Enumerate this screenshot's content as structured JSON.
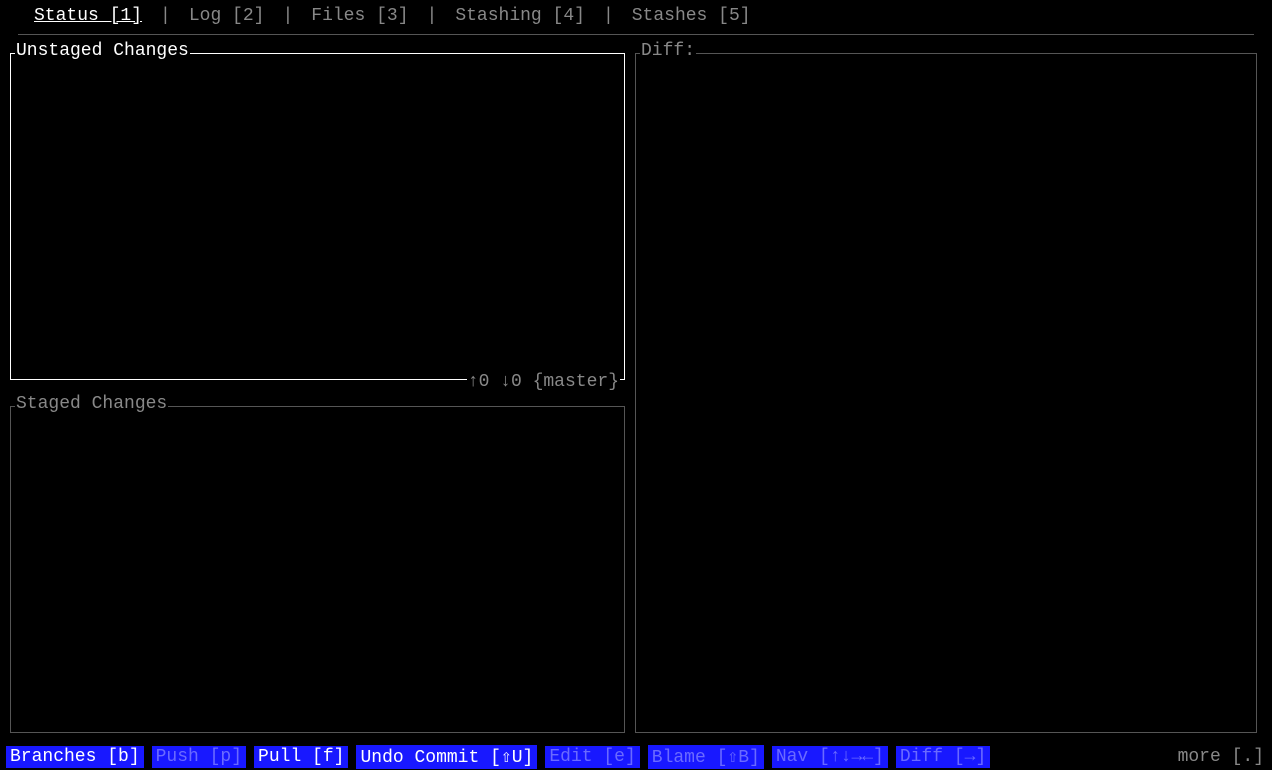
{
  "tabs": [
    {
      "label": "Status [1]",
      "active": true
    },
    {
      "label": "Log [2]",
      "active": false
    },
    {
      "label": "Files [3]",
      "active": false
    },
    {
      "label": "Stashing [4]",
      "active": false
    },
    {
      "label": "Stashes [5]",
      "active": false
    }
  ],
  "panels": {
    "unstaged": {
      "title": "Unstaged Changes",
      "footer": "↑0 ↓0 {master}"
    },
    "staged": {
      "title": "Staged Changes"
    },
    "diff": {
      "title": "Diff:"
    }
  },
  "commands": [
    {
      "label": "Branches [b]",
      "enabled": true
    },
    {
      "label": "Push [p]",
      "enabled": false
    },
    {
      "label": "Pull [f]",
      "enabled": true
    },
    {
      "label": "Undo Commit [⇧U]",
      "enabled": true
    },
    {
      "label": "Edit [e]",
      "enabled": false
    },
    {
      "label": "Blame [⇧B]",
      "enabled": false
    },
    {
      "label": "Nav [↑↓→←]",
      "enabled": false
    },
    {
      "label": "Diff [→]",
      "enabled": false
    }
  ],
  "more_label": "more [.]"
}
